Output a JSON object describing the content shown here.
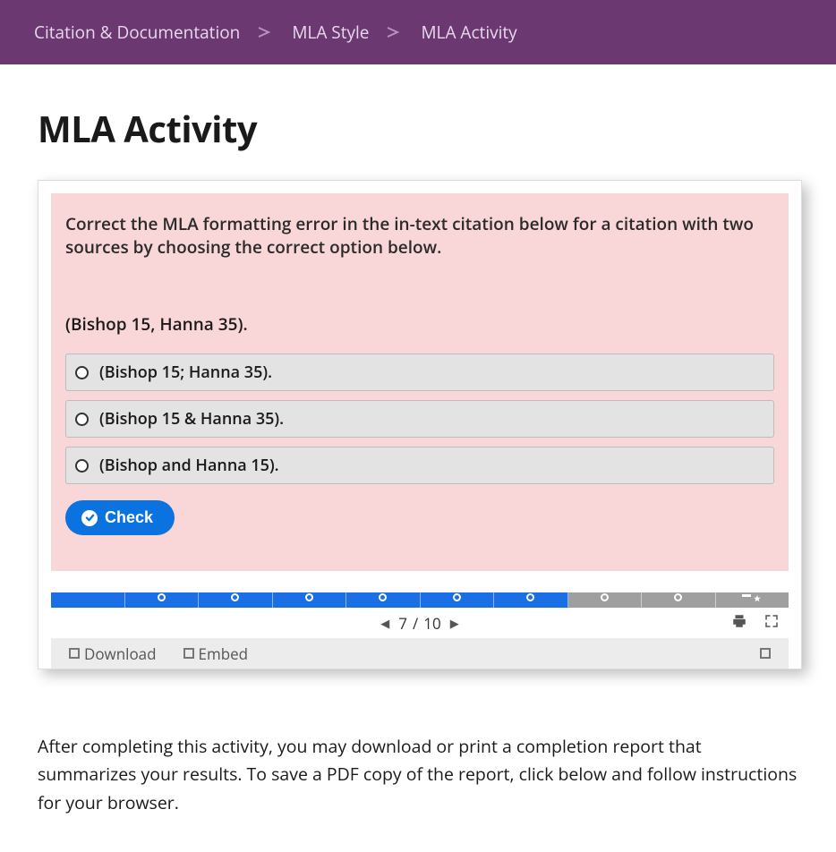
{
  "breadcrumb": {
    "items": [
      "Citation & Documentation",
      "MLA Style",
      "MLA Activity"
    ]
  },
  "page": {
    "title": "MLA Activity"
  },
  "quiz": {
    "question": "Correct the MLA formatting error in the in-text citation below for a citation with two sources by choosing the correct option below.",
    "example": "(Bishop 15, Hanna 35).",
    "options": [
      "(Bishop 15; Hanna 35).",
      "(Bishop 15 & Hanna 35).",
      "(Bishop and Hanna 15)."
    ],
    "check_label": "Check"
  },
  "progress": {
    "total": 10,
    "current": 7,
    "completed_segments": 7
  },
  "pager": {
    "current": "7",
    "sep": "/",
    "total": "10"
  },
  "footer": {
    "download": "Download",
    "embed": "Embed"
  },
  "after_text": "After completing this activity, you may download or print a completion report that summarizes your results. To save a PDF copy of the report, click below and follow instructions for your browser."
}
